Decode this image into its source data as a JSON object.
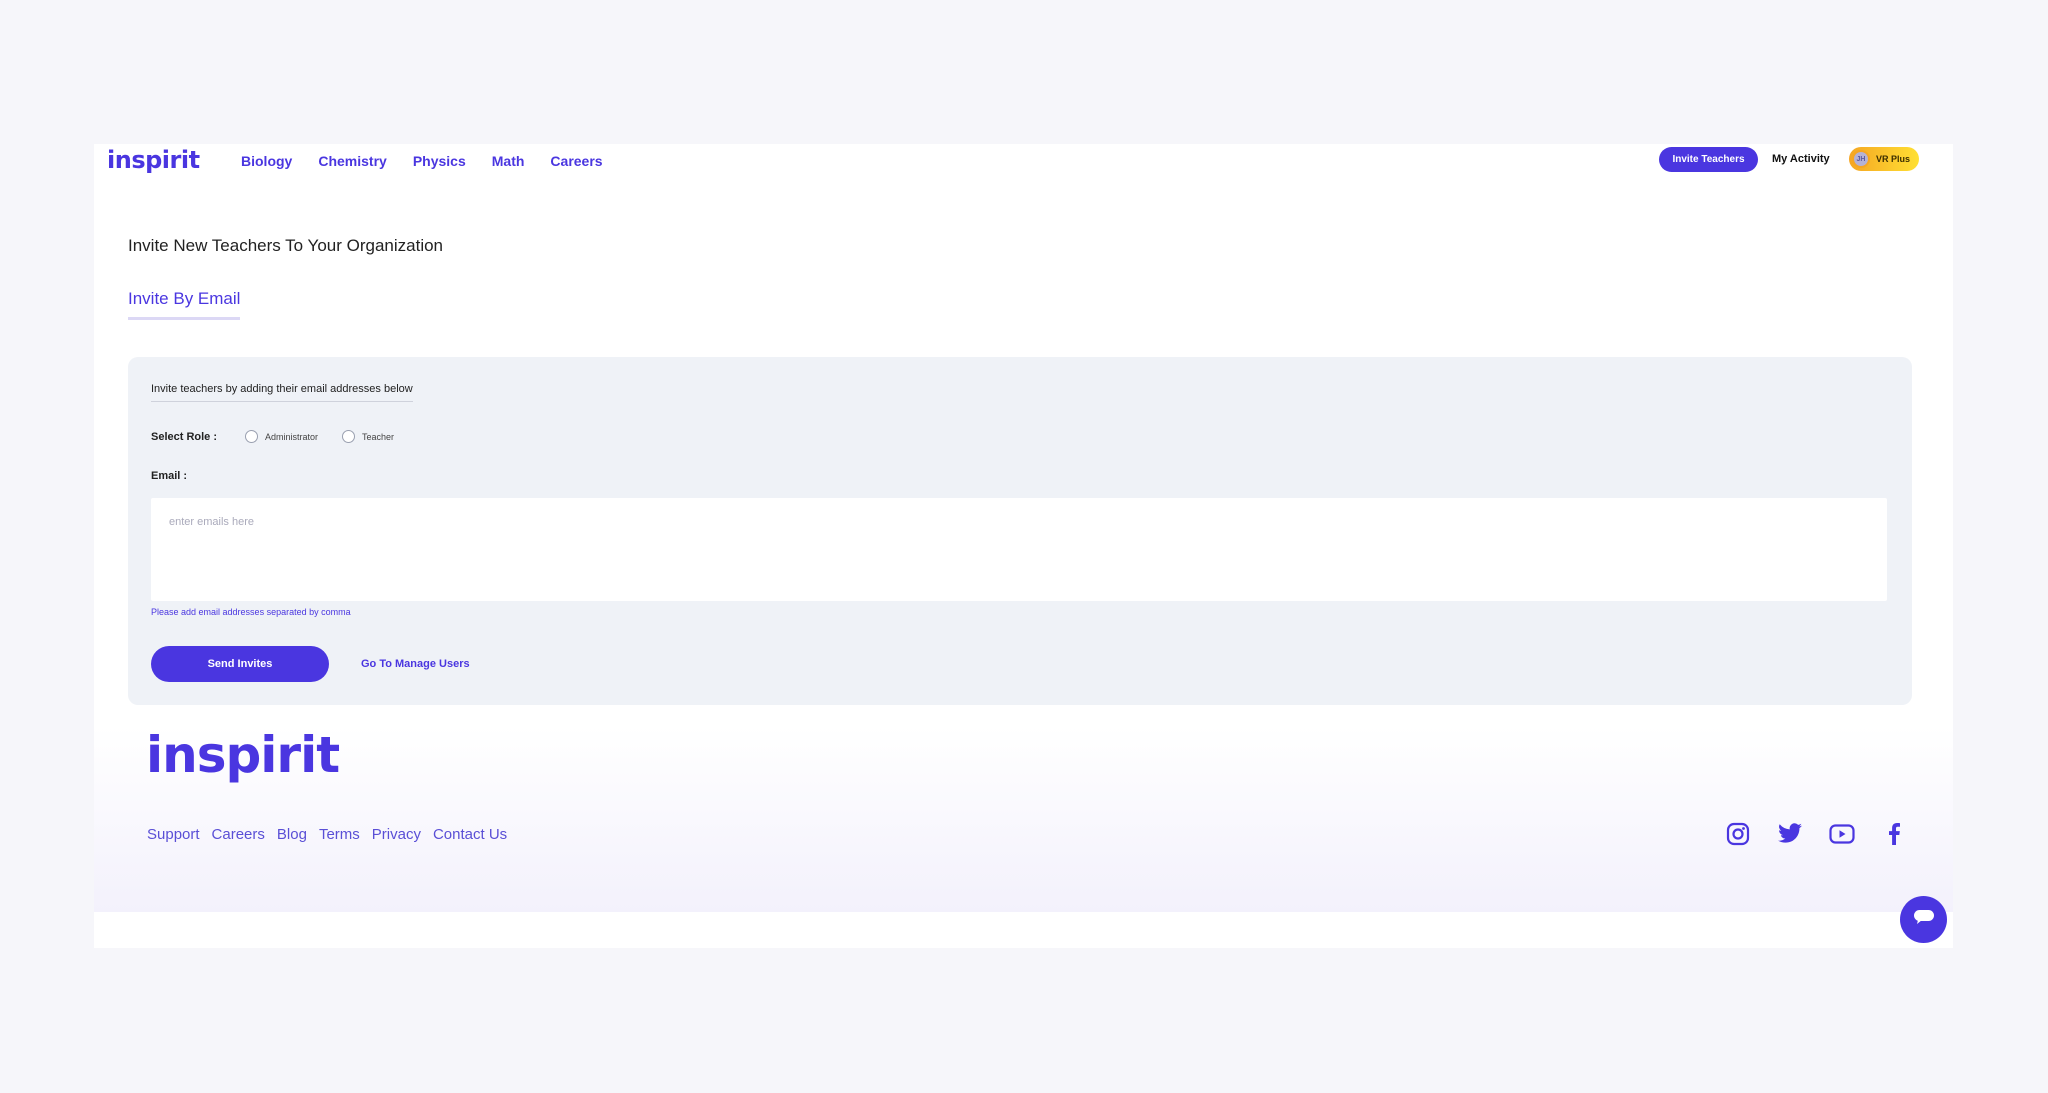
{
  "header": {
    "logo": "inspirit",
    "nav": [
      "Biology",
      "Chemistry",
      "Physics",
      "Math",
      "Careers"
    ],
    "invite_button": "Invite Teachers",
    "my_activity": "My Activity",
    "avatar_initials": "JH",
    "plan_badge": "VR Plus"
  },
  "main": {
    "title": "Invite New Teachers To Your Organization",
    "tab_label": "Invite By Email",
    "panel": {
      "hint": "Invite teachers by adding their email addresses below",
      "role_label": "Select Role :",
      "roles": [
        "Administrator",
        "Teacher"
      ],
      "email_label": "Email :",
      "email_placeholder": "enter emails here",
      "email_value": "",
      "email_note": "Please add email addresses separated by comma",
      "send_button": "Send Invites",
      "manage_link": "Go To Manage Users"
    }
  },
  "footer": {
    "logo": "inspirit",
    "links": [
      "Support",
      "Careers",
      "Blog",
      "Terms",
      "Privacy",
      "Contact Us"
    ],
    "socials": [
      "instagram-icon",
      "twitter-icon",
      "youtube-icon",
      "facebook-icon"
    ]
  },
  "colors": {
    "accent": "#4a36e0",
    "panel_bg": "#eff2f7",
    "badge_gold": "#f5c518"
  }
}
